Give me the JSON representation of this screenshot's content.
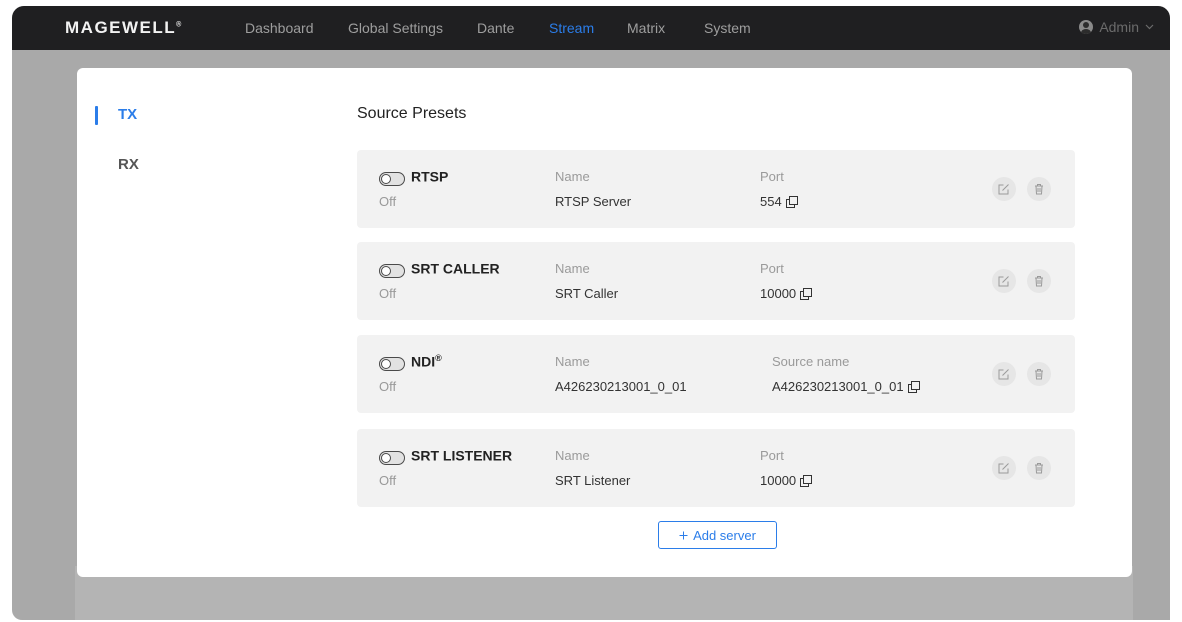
{
  "brand": {
    "logo": "MAGEWELL",
    "registered": "®"
  },
  "nav": {
    "items": [
      {
        "label": "Dashboard",
        "active": false
      },
      {
        "label": "Global Settings",
        "active": false
      },
      {
        "label": "Dante",
        "active": false
      },
      {
        "label": "Stream",
        "active": true
      },
      {
        "label": "Matrix",
        "active": false
      },
      {
        "label": "System",
        "active": false
      }
    ],
    "user": {
      "label": "Admin",
      "icon": "user-icon",
      "dropdown_icon": "chevron-down-icon"
    }
  },
  "sidebar": {
    "tabs": [
      {
        "label": "TX",
        "active": true
      },
      {
        "label": "RX",
        "active": false
      }
    ]
  },
  "main": {
    "section_title": "Source Presets",
    "presets": [
      {
        "protocol": "RTSP",
        "sup": "",
        "state": "Off",
        "name_label": "Name",
        "name_value": "RTSP Server",
        "field_label": "Port",
        "field_value": "554"
      },
      {
        "protocol": "SRT CALLER",
        "sup": "",
        "state": "Off",
        "name_label": "Name",
        "name_value": "SRT Caller",
        "field_label": "Port",
        "field_value": "10000"
      },
      {
        "protocol": "NDI",
        "sup": "®",
        "state": "Off",
        "name_label": "Name",
        "name_value": "A426230213001_0_01",
        "field_label": "Source name",
        "field_value": "A426230213001_0_01"
      },
      {
        "protocol": "SRT LISTENER",
        "sup": "",
        "state": "Off",
        "name_label": "Name",
        "name_value": "SRT Listener",
        "field_label": "Port",
        "field_value": "10000"
      }
    ],
    "add_button": {
      "label": "Add server",
      "icon": "plus-icon"
    }
  },
  "colors": {
    "accent": "#2b7de9",
    "topbar": "#1f1f21",
    "card": "#f2f2f2"
  }
}
